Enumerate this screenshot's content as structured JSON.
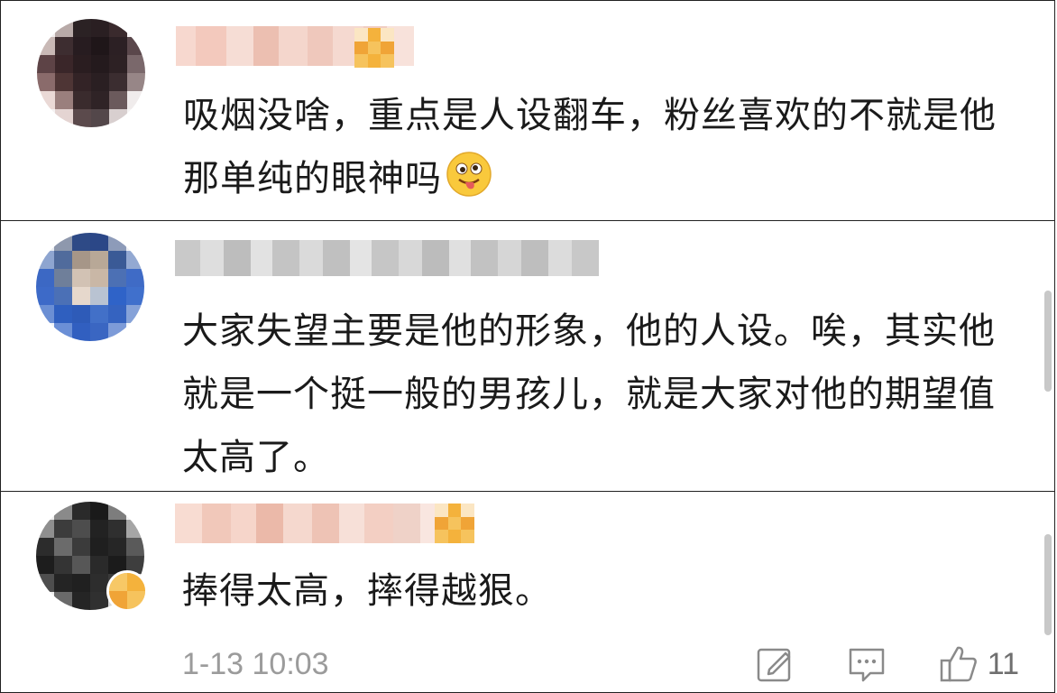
{
  "comments": [
    {
      "username": "",
      "text": "吸烟没啥，重点是人设翻车，粉丝喜欢的不就是他那单纯的眼神吗",
      "emoji": "tongue-out-emoji"
    },
    {
      "username": "",
      "text": "大家失望主要是他的形象，他的人设。唉，其实他就是一个挺一般的男孩儿，就是大家对他的期望值太高了。"
    },
    {
      "username": "",
      "text": "捧得太高，摔得越狠。",
      "timestamp": "1-13 10:03",
      "like_count": "11",
      "actions": [
        "edit-icon",
        "comment-icon",
        "like-icon"
      ]
    }
  ],
  "colors": {
    "text": "#1a1a1a",
    "meta": "#9b9b9b",
    "border": "#222222",
    "medal": "#f4b23c"
  }
}
